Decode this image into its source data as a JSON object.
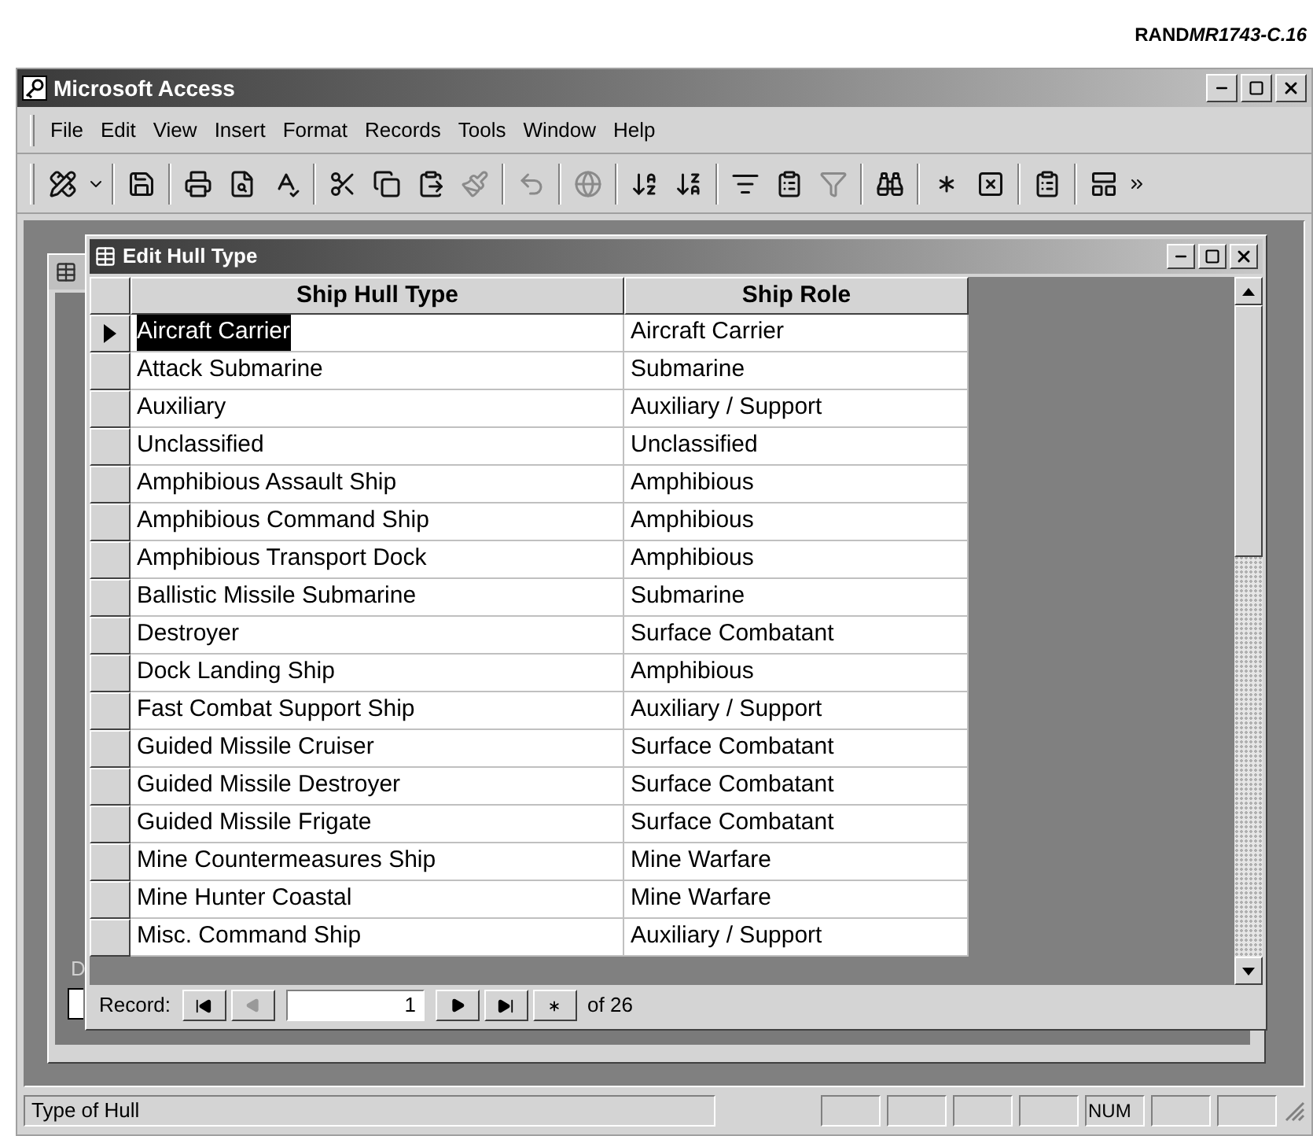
{
  "figure_id": {
    "prefix": "RAND",
    "code": "MR1743-C.16"
  },
  "window": {
    "title": "Microsoft Access"
  },
  "menu": [
    "File",
    "Edit",
    "View",
    "Insert",
    "Format",
    "Records",
    "Tools",
    "Window",
    "Help"
  ],
  "background_form": {
    "label": "D"
  },
  "form": {
    "title": "Edit Hull Type",
    "columns": [
      "Ship Hull Type",
      "Ship Role"
    ],
    "rows": [
      {
        "hull_type": "Aircraft Carrier",
        "role": "Aircraft Carrier",
        "selected": true
      },
      {
        "hull_type": "Attack Submarine",
        "role": "Submarine",
        "selected": false
      },
      {
        "hull_type": "Auxiliary",
        "role": "Auxiliary / Support",
        "selected": false
      },
      {
        "hull_type": "Unclassified",
        "role": "Unclassified",
        "selected": false
      },
      {
        "hull_type": "Amphibious Assault Ship",
        "role": "Amphibious",
        "selected": false
      },
      {
        "hull_type": "Amphibious Command Ship",
        "role": "Amphibious",
        "selected": false
      },
      {
        "hull_type": "Amphibious Transport Dock",
        "role": "Amphibious",
        "selected": false
      },
      {
        "hull_type": "Ballistic Missile Submarine",
        "role": "Submarine",
        "selected": false
      },
      {
        "hull_type": "Destroyer",
        "role": "Surface Combatant",
        "selected": false
      },
      {
        "hull_type": "Dock Landing Ship",
        "role": "Amphibious",
        "selected": false
      },
      {
        "hull_type": "Fast Combat Support Ship",
        "role": "Auxiliary / Support",
        "selected": false
      },
      {
        "hull_type": "Guided Missile Cruiser",
        "role": "Surface Combatant",
        "selected": false
      },
      {
        "hull_type": "Guided Missile Destroyer",
        "role": "Surface Combatant",
        "selected": false
      },
      {
        "hull_type": "Guided Missile Frigate",
        "role": "Surface Combatant",
        "selected": false
      },
      {
        "hull_type": "Mine Countermeasures Ship",
        "role": "Mine Warfare",
        "selected": false
      },
      {
        "hull_type": "Mine Hunter Coastal",
        "role": "Mine Warfare",
        "selected": false
      },
      {
        "hull_type": "Misc. Command Ship",
        "role": "Auxiliary / Support",
        "selected": false
      }
    ],
    "navigation": {
      "label": "Record:",
      "current": "1",
      "total": "of 26"
    }
  },
  "status_bar": {
    "message": "Type of Hull",
    "indicators": [
      {
        "kind": "blank"
      },
      {
        "kind": "blank"
      },
      {
        "kind": "blank"
      },
      {
        "kind": "blank"
      },
      {
        "kind": "text",
        "text": "NUM"
      },
      {
        "kind": "blank"
      },
      {
        "kind": "blank"
      }
    ]
  }
}
